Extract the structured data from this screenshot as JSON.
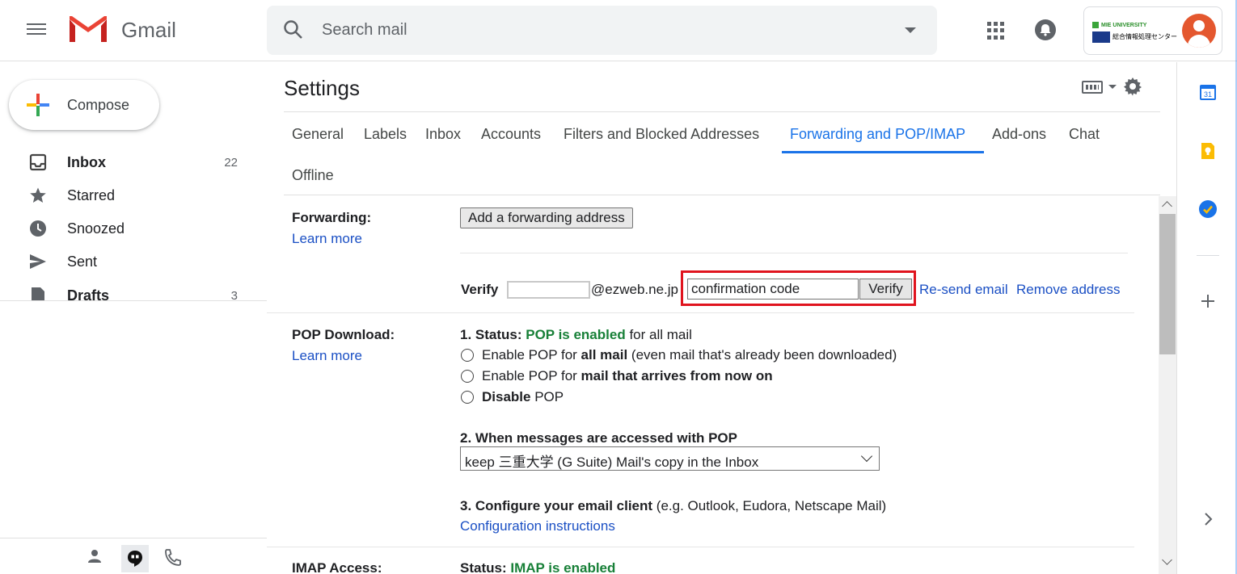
{
  "header": {
    "app_name": "Gmail",
    "search_placeholder": "Search mail",
    "org_logo": {
      "line1": "MIE UNIVERSITY",
      "line2": "総合情報処理センター"
    }
  },
  "sidebar": {
    "compose_label": "Compose",
    "items": [
      {
        "label": "Inbox",
        "count": "22",
        "bold": true
      },
      {
        "label": "Starred",
        "count": ""
      },
      {
        "label": "Snoozed",
        "count": ""
      },
      {
        "label": "Sent",
        "count": ""
      },
      {
        "label": "Drafts",
        "count": "3",
        "bold": true
      }
    ]
  },
  "settings": {
    "title": "Settings",
    "tabs": [
      {
        "label": "General"
      },
      {
        "label": "Labels"
      },
      {
        "label": "Inbox"
      },
      {
        "label": "Accounts"
      },
      {
        "label": "Filters and Blocked Addresses"
      },
      {
        "label": "Forwarding and POP/IMAP",
        "active": true
      },
      {
        "label": "Add-ons"
      },
      {
        "label": "Chat"
      },
      {
        "label": "Offline"
      }
    ],
    "forwarding": {
      "title": "Forwarding:",
      "learn_more": "Learn more",
      "add_button": "Add a forwarding address",
      "verify_label": "Verify",
      "email_domain": "@ezweb.ne.jp",
      "confirmation_placeholder": "confirmation code",
      "confirmation_value": "confirmation code",
      "verify_button": "Verify",
      "resend": "Re-send email",
      "remove": "Remove address"
    },
    "pop": {
      "title": "POP Download:",
      "learn_more": "Learn more",
      "status_prefix": "1. Status: ",
      "status_value": "POP is enabled",
      "status_suffix": " for all mail",
      "option1_pre": "Enable POP for ",
      "option1_bold": "all mail",
      "option1_post": " (even mail that's already been downloaded)",
      "option2_pre": "Enable POP for ",
      "option2_bold": "mail that arrives from now on",
      "option3_bold": "Disable",
      "option3_post": " POP",
      "step2_title": "2. When messages are accessed with POP",
      "step2_selected": "keep 三重大学 (G Suite) Mail's copy in the Inbox",
      "step3_title": "3. Configure your email client",
      "step3_post": " (e.g. Outlook, Eudora, Netscape Mail)",
      "config_link": "Configuration instructions"
    },
    "imap": {
      "title": "IMAP Access:",
      "status_prefix": "Status: ",
      "status_value": "IMAP is enabled"
    }
  },
  "side_panel": {
    "calendar_day": "31"
  },
  "colors": {
    "accent": "#1a73e8",
    "link": "#1a4fc4",
    "enabled_green": "#188038",
    "highlight_red": "#e0141e"
  }
}
